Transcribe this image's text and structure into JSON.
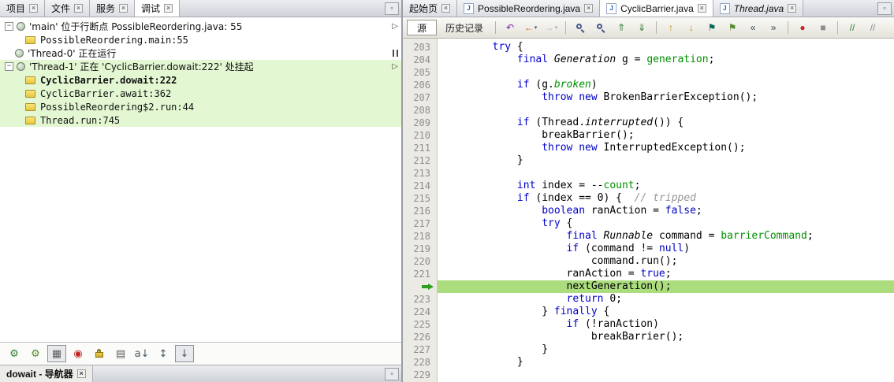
{
  "colors": {
    "current_line": "#ABDD7E",
    "selection": "#E3F7D2",
    "keyword": "#0000C8",
    "field": "#009000",
    "comment": "#969696"
  },
  "icons": {
    "close": "×",
    "minimize": "▫",
    "java_file": "J",
    "resume": "▷",
    "collapse": "−"
  },
  "debugger": {
    "window_tabs": [
      "项目",
      "文件",
      "服务",
      "调试"
    ],
    "active_window_tab": "调试",
    "tree": [
      {
        "kind": "thread",
        "handle": true,
        "label": "'main' 位于行断点 PossibleReordering.java: 55",
        "action": "resume",
        "selected": false
      },
      {
        "kind": "frame",
        "label": "PossibleReordering.main:55",
        "selected": false
      },
      {
        "kind": "thread",
        "handle": false,
        "label": "'Thread-0' 正在运行",
        "action": "pause",
        "selected": false
      },
      {
        "kind": "thread",
        "handle": true,
        "label": "'Thread-1' 正在 'CyclicBarrier.dowait:222' 处挂起",
        "action": "resume",
        "selected": true
      },
      {
        "kind": "frame",
        "label": "CyclicBarrier.dowait:222",
        "bold": true,
        "selected": true
      },
      {
        "kind": "frame",
        "label": "CyclicBarrier.await:362",
        "selected": true
      },
      {
        "kind": "frame",
        "label": "PossibleReordering$2.run:44",
        "selected": true
      },
      {
        "kind": "frame",
        "label": "Thread.run:745",
        "selected": true
      }
    ],
    "toolbar_icons": [
      {
        "name": "show-suspended-threads-icon",
        "glyph": "⚙",
        "color": "#2E7D32"
      },
      {
        "name": "show-thread-groups-icon",
        "glyph": "⚙",
        "color": "#558B2F"
      },
      {
        "name": "show-suspend-resume-table-icon",
        "glyph": "▦",
        "color": "#5b5b5b",
        "pressed": true
      },
      {
        "name": "show-deadlocks-icon",
        "glyph": "◉",
        "color": "#C62828"
      },
      {
        "name": "show-monitors-icon",
        "kind": "lock"
      },
      {
        "name": "show-qualified-names-icon",
        "glyph": "▤",
        "color": "#5b5b5b"
      },
      {
        "name": "sort-alphabetic-icon",
        "glyph": "a↓",
        "color": "#455A64"
      },
      {
        "name": "sort-suspended-icon",
        "glyph": "↕",
        "color": "#455A64"
      },
      {
        "name": "sort-natural-icon",
        "glyph": "↓",
        "color": "#455A64",
        "pressed": true
      }
    ],
    "bottom_tab": "dowait - 导航器"
  },
  "editor": {
    "tabs": [
      {
        "label": "起始页",
        "icon": "none",
        "active": false,
        "italic": false
      },
      {
        "label": "PossibleReordering.java",
        "icon": "java",
        "active": false,
        "italic": false
      },
      {
        "label": "CyclicBarrier.java",
        "icon": "java",
        "active": true,
        "italic": false
      },
      {
        "label": "Thread.java",
        "icon": "java",
        "active": false,
        "italic": true
      }
    ],
    "toolbar": {
      "source": "源",
      "history": "历史记录",
      "icons": [
        {
          "name": "last-edit-icon",
          "glyph": "↶",
          "color": "#7B1FA2"
        },
        {
          "name": "back-icon",
          "glyph": "←",
          "color": "#E65100",
          "caret": true
        },
        {
          "name": "forward-icon",
          "glyph": "→",
          "color": "#8D8D8D",
          "caret": true,
          "disabled": true
        },
        {
          "kind": "sep"
        },
        {
          "name": "find-icon",
          "kind": "mag"
        },
        {
          "name": "replace-icon",
          "kind": "mag"
        },
        {
          "name": "find-previous-selection-icon",
          "glyph": "⇑",
          "color": "#2E7D32"
        },
        {
          "name": "find-next-selection-icon",
          "glyph": "⇓",
          "color": "#2E7D32"
        },
        {
          "kind": "sep"
        },
        {
          "name": "previous-occurrence-icon",
          "glyph": "↑",
          "color": "#C49000"
        },
        {
          "name": "next-occurrence-icon",
          "glyph": "↓",
          "color": "#C49000"
        },
        {
          "name": "previous-bookmark-icon",
          "glyph": "⚑",
          "color": "#00695C"
        },
        {
          "name": "next-bookmark-icon",
          "glyph": "⚑",
          "color": "#558B2F"
        },
        {
          "name": "shift-left-icon",
          "glyph": "«",
          "color": "#37474F"
        },
        {
          "name": "shift-right-icon",
          "glyph": "»",
          "color": "#37474F"
        },
        {
          "kind": "sep"
        },
        {
          "name": "record-macro-icon",
          "glyph": "●",
          "color": "#C62828"
        },
        {
          "name": "stop-macro-icon",
          "glyph": "■",
          "color": "#8D8D8D"
        },
        {
          "kind": "sep"
        },
        {
          "name": "comment-icon",
          "glyph": "//",
          "color": "#2E7D32"
        },
        {
          "name": "uncomment-icon",
          "glyph": "//",
          "color": "#8D8D8D"
        }
      ]
    },
    "current_line": 222,
    "lines": [
      {
        "n": 203,
        "tok": [
          [
            "p",
            "        "
          ],
          [
            "k",
            "try"
          ],
          [
            "p",
            " {"
          ]
        ]
      },
      {
        "n": 204,
        "tok": [
          [
            "p",
            "            "
          ],
          [
            "k",
            "final"
          ],
          [
            "p",
            " "
          ],
          [
            "t",
            "Generation"
          ],
          [
            "p",
            " g = "
          ],
          [
            "f",
            "generation"
          ],
          [
            "p",
            ";"
          ]
        ]
      },
      {
        "n": 205,
        "tok": []
      },
      {
        "n": 206,
        "tok": [
          [
            "p",
            "            "
          ],
          [
            "k",
            "if"
          ],
          [
            "p",
            " (g."
          ],
          [
            "fi",
            "broken"
          ],
          [
            "p",
            ")"
          ]
        ]
      },
      {
        "n": 207,
        "tok": [
          [
            "p",
            "                "
          ],
          [
            "k",
            "throw"
          ],
          [
            "p",
            " "
          ],
          [
            "k",
            "new"
          ],
          [
            "p",
            " BrokenBarrierException();"
          ]
        ]
      },
      {
        "n": 208,
        "tok": []
      },
      {
        "n": 209,
        "tok": [
          [
            "p",
            "            "
          ],
          [
            "k",
            "if"
          ],
          [
            "p",
            " (Thread."
          ],
          [
            "t",
            "interrupted"
          ],
          [
            "p",
            "()) {"
          ]
        ]
      },
      {
        "n": 210,
        "tok": [
          [
            "p",
            "                breakBarrier();"
          ]
        ]
      },
      {
        "n": 211,
        "tok": [
          [
            "p",
            "                "
          ],
          [
            "k",
            "throw"
          ],
          [
            "p",
            " "
          ],
          [
            "k",
            "new"
          ],
          [
            "p",
            " InterruptedException();"
          ]
        ]
      },
      {
        "n": 212,
        "tok": [
          [
            "p",
            "            }"
          ]
        ]
      },
      {
        "n": 213,
        "tok": []
      },
      {
        "n": 214,
        "tok": [
          [
            "p",
            "            "
          ],
          [
            "k",
            "int"
          ],
          [
            "p",
            " index = --"
          ],
          [
            "f",
            "count"
          ],
          [
            "p",
            ";"
          ]
        ]
      },
      {
        "n": 215,
        "tok": [
          [
            "p",
            "            "
          ],
          [
            "k",
            "if"
          ],
          [
            "p",
            " (index == 0) {  "
          ],
          [
            "c",
            "// tripped"
          ]
        ]
      },
      {
        "n": 216,
        "tok": [
          [
            "p",
            "                "
          ],
          [
            "k",
            "boolean"
          ],
          [
            "p",
            " ranAction = "
          ],
          [
            "k",
            "false"
          ],
          [
            "p",
            ";"
          ]
        ]
      },
      {
        "n": 217,
        "tok": [
          [
            "p",
            "                "
          ],
          [
            "k",
            "try"
          ],
          [
            "p",
            " {"
          ]
        ]
      },
      {
        "n": 218,
        "tok": [
          [
            "p",
            "                    "
          ],
          [
            "k",
            "final"
          ],
          [
            "p",
            " "
          ],
          [
            "t",
            "Runnable"
          ],
          [
            "p",
            " command = "
          ],
          [
            "f",
            "barrierCommand"
          ],
          [
            "p",
            ";"
          ]
        ]
      },
      {
        "n": 219,
        "tok": [
          [
            "p",
            "                    "
          ],
          [
            "k",
            "if"
          ],
          [
            "p",
            " (command != "
          ],
          [
            "k",
            "null"
          ],
          [
            "p",
            ")"
          ]
        ]
      },
      {
        "n": 220,
        "tok": [
          [
            "p",
            "                        command.run();"
          ]
        ]
      },
      {
        "n": 221,
        "tok": [
          [
            "p",
            "                    ranAction = "
          ],
          [
            "k",
            "true"
          ],
          [
            "p",
            ";"
          ]
        ]
      },
      {
        "n": 222,
        "tok": [
          [
            "p",
            "                    nextGeneration();"
          ]
        ]
      },
      {
        "n": 223,
        "tok": [
          [
            "p",
            "                    "
          ],
          [
            "k",
            "return"
          ],
          [
            "p",
            " 0;"
          ]
        ]
      },
      {
        "n": 224,
        "tok": [
          [
            "p",
            "                } "
          ],
          [
            "k",
            "finally"
          ],
          [
            "p",
            " {"
          ]
        ]
      },
      {
        "n": 225,
        "tok": [
          [
            "p",
            "                    "
          ],
          [
            "k",
            "if"
          ],
          [
            "p",
            " (!ranAction)"
          ]
        ]
      },
      {
        "n": 226,
        "tok": [
          [
            "p",
            "                        breakBarrier();"
          ]
        ]
      },
      {
        "n": 227,
        "tok": [
          [
            "p",
            "                }"
          ]
        ]
      },
      {
        "n": 228,
        "tok": [
          [
            "p",
            "            }"
          ]
        ]
      },
      {
        "n": 229,
        "tok": []
      }
    ]
  }
}
